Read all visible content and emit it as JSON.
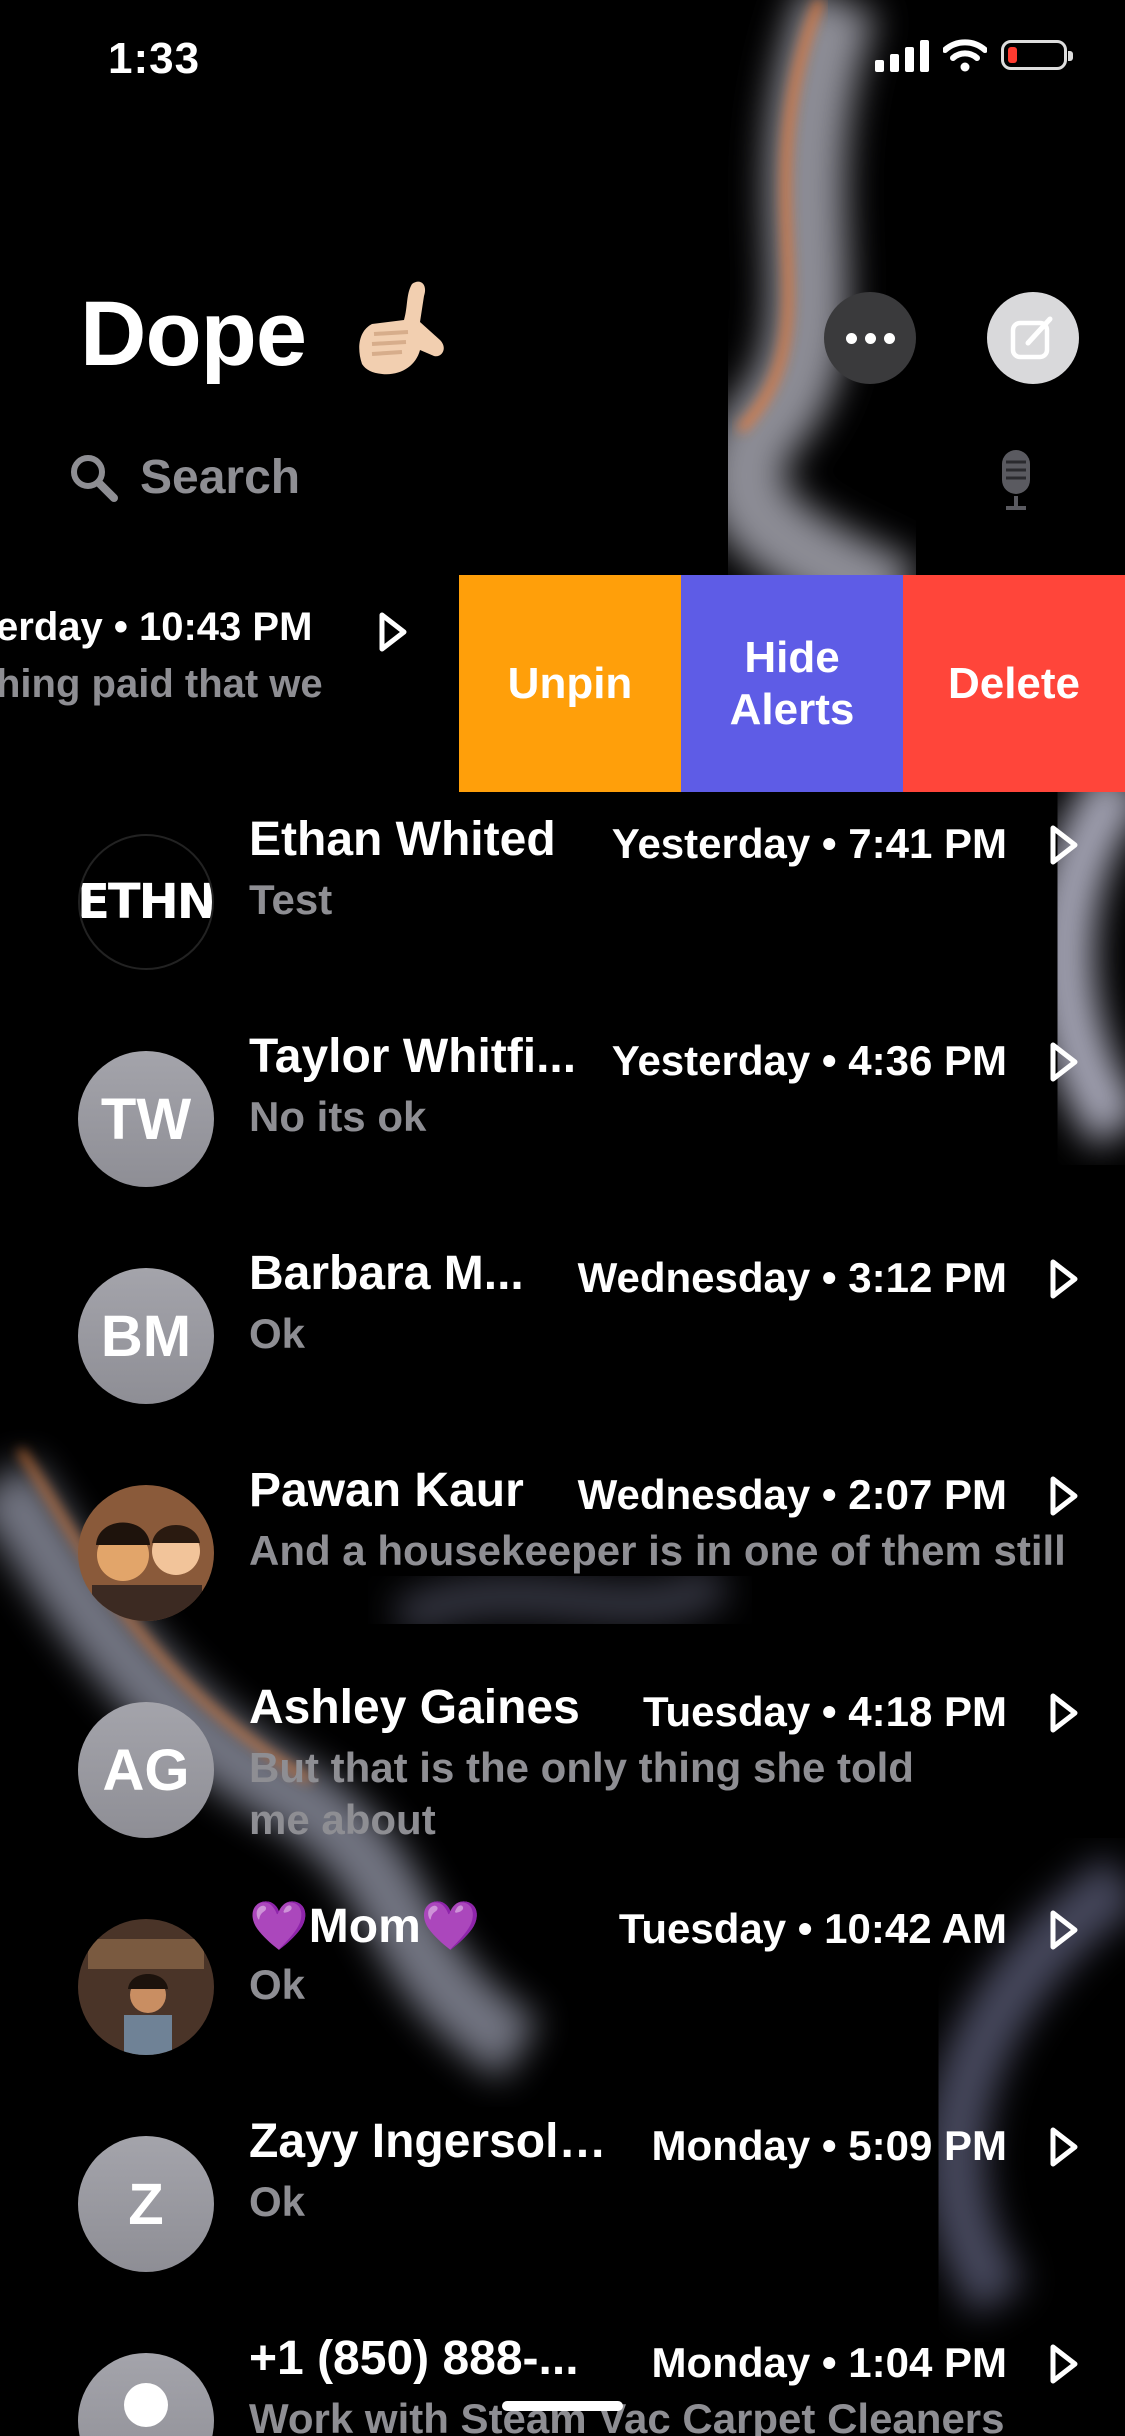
{
  "status_bar": {
    "time": "1:33"
  },
  "header": {
    "title": "Dope",
    "title_emoji": "call-me-hand-emoji"
  },
  "search": {
    "placeholder": "Search"
  },
  "pinned_row": {
    "time": "erday • 10:43 PM",
    "preview": "hing paid that we",
    "actions": {
      "unpin": "Unpin",
      "hide_line1": "Hide",
      "hide_line2": "Alerts",
      "delete": "Delete"
    },
    "colors": {
      "unpin": "#ff9f0a",
      "hide": "#5e5ce6",
      "delete": "#ff453a"
    }
  },
  "conversations": [
    {
      "name": "Ethan Whited",
      "time": "Yesterday • 7:41 PM",
      "preview": "Test",
      "avatar": "ETHN"
    },
    {
      "name": "Taylor Whitfi...",
      "time": "Yesterday • 4:36 PM",
      "preview": "No its ok",
      "avatar": "TW"
    },
    {
      "name": "Barbara M...",
      "time": "Wednesday • 3:12 PM",
      "preview": "Ok",
      "avatar": "BM"
    },
    {
      "name": "Pawan Kaur",
      "time": "Wednesday • 2:07 PM",
      "preview": "And a housekeeper is in one of them still",
      "avatar": "photo"
    },
    {
      "name": "Ashley Gaines",
      "time": "Tuesday • 4:18 PM",
      "preview": "But that is the only thing she told me about",
      "avatar": "AG"
    },
    {
      "name": "💜Mom💜",
      "time": "Tuesday • 10:42 AM",
      "preview": "Ok",
      "avatar": "photo"
    },
    {
      "name": "Zayy Ingersoll...",
      "time": "Monday • 5:09 PM",
      "preview": "Ok",
      "avatar": "Z"
    },
    {
      "name": "+1 (850) 888-...",
      "time": "Monday • 1:04 PM",
      "preview": "Work with Steam Vac Carpet Cleaners",
      "avatar": "person"
    }
  ]
}
